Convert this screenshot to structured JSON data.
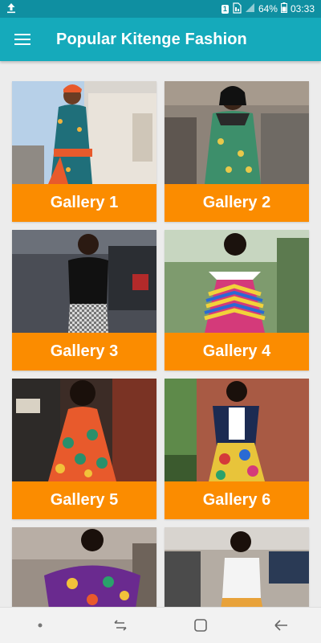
{
  "status_bar": {
    "sim_number": "1",
    "battery": "64%",
    "time": "03:33",
    "icons": [
      "upload-icon",
      "sim-icon",
      "signal-icon",
      "battery-icon"
    ]
  },
  "toolbar": {
    "title": "Popular Kitenge Fashion",
    "menu_icon": "hamburger-menu-icon"
  },
  "colors": {
    "status_bar": "#0f8fa1",
    "toolbar": "#15aabb",
    "card_label": "#fb8c00",
    "label_text": "#ffffff",
    "background": "#ececec"
  },
  "galleries": [
    {
      "label": "Gallery 1"
    },
    {
      "label": "Gallery 2"
    },
    {
      "label": "Gallery 3"
    },
    {
      "label": "Gallery 4"
    },
    {
      "label": "Gallery 5"
    },
    {
      "label": "Gallery 6"
    },
    {
      "label": ""
    },
    {
      "label": ""
    }
  ],
  "nav_bar": {
    "icons": [
      "dot-icon",
      "recent-apps-icon",
      "home-icon",
      "back-icon"
    ]
  }
}
